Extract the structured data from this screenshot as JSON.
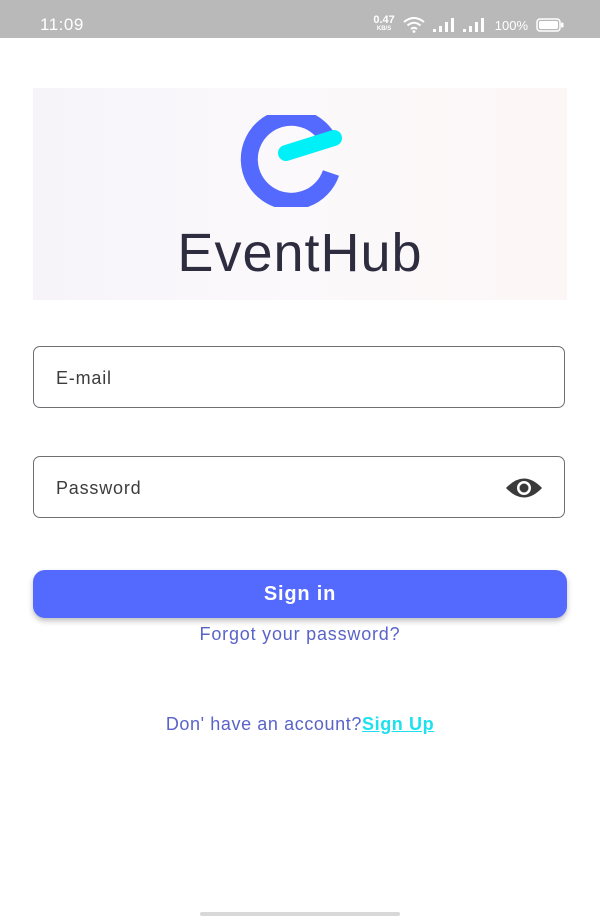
{
  "status_bar": {
    "time": "11:09",
    "net_speed_value": "0.47",
    "net_speed_unit": "KB/S",
    "battery_percent": "100%",
    "icons": [
      "wifi-icon",
      "signal-icon",
      "signal-icon",
      "battery-icon"
    ]
  },
  "logo": {
    "wordmark": "EventHub",
    "colors": {
      "ring": "#5469fd",
      "accent": "#00f0f8",
      "wordmark": "#2e2d40"
    }
  },
  "form": {
    "email_placeholder": "E-mail",
    "email_value": "",
    "password_placeholder": "Password",
    "password_value": "",
    "password_toggle_icon": "eye-icon",
    "sign_in_label": "Sign in",
    "forgot_password": "Forgot your password?"
  },
  "signup": {
    "prompt": "Don' have an account?",
    "link": "Sign Up"
  },
  "colors": {
    "primary": "#5469fd",
    "link": "#5a63c9",
    "signup_link": "#1ee0ee",
    "status_bar": "#b9b9b9"
  }
}
